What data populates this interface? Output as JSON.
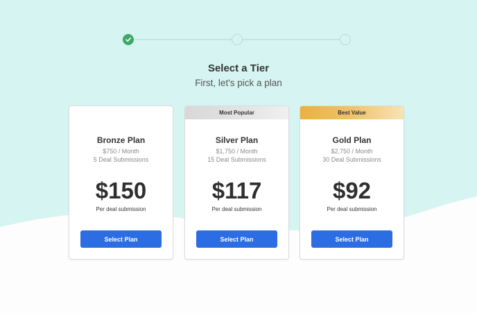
{
  "colors": {
    "teal_bg": "#d6f4f1",
    "accent_blue": "#2c6de3",
    "check_green": "#3ea86b",
    "gold": "#eab13e"
  },
  "stepper": {
    "steps": [
      {
        "state": "completed",
        "icon": "check-icon"
      },
      {
        "state": "pending"
      },
      {
        "state": "pending"
      }
    ]
  },
  "header": {
    "title": "Select a Tier",
    "subtitle": "First, let's pick a plan"
  },
  "plans": [
    {
      "ribbon": "",
      "name": "Bronze Plan",
      "monthly": "$750 / Month",
      "submissions": "5 Deal Submissions",
      "price": "$150",
      "per_deal": "Per deal submission",
      "button": "Select Plan"
    },
    {
      "ribbon": "Most Popular",
      "name": "Silver Plan",
      "monthly": "$1,750 / Month",
      "submissions": "15 Deal Submissions",
      "price": "$117",
      "per_deal": "Per deal submission",
      "button": "Select Plan"
    },
    {
      "ribbon": "Best Value",
      "name": "Gold Plan",
      "monthly": "$2,750 / Month",
      "submissions": "30 Deal Submissions",
      "price": "$92",
      "per_deal": "Per deal submission",
      "button": "Select Plan"
    }
  ]
}
